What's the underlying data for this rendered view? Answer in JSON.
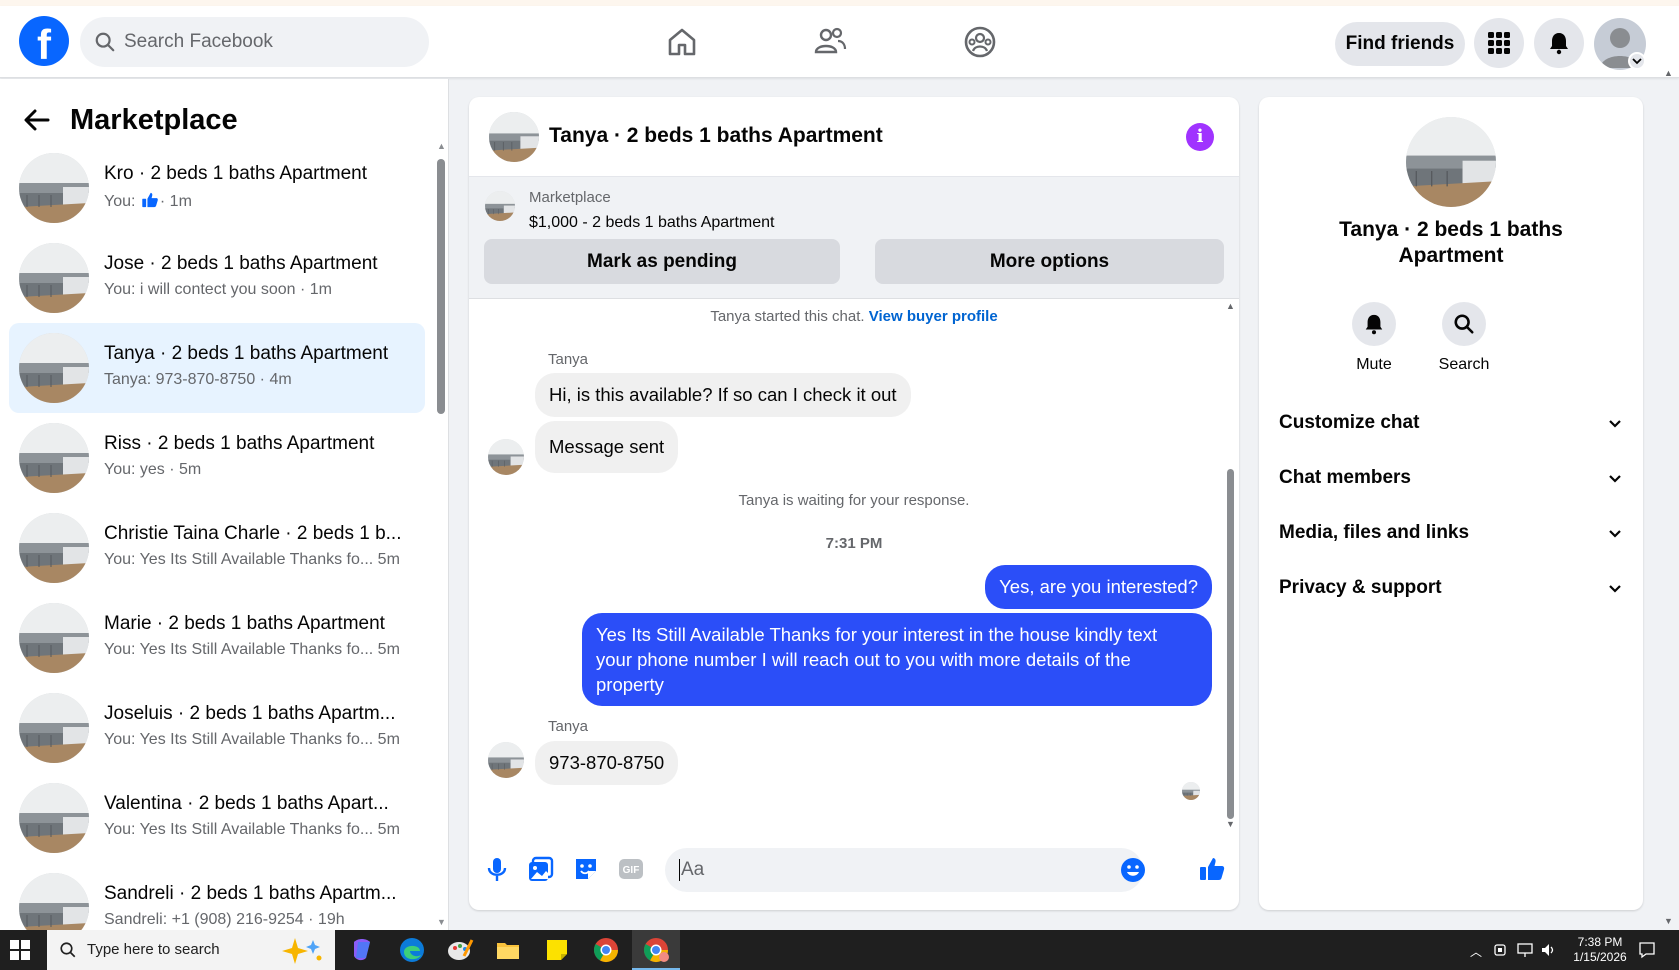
{
  "header": {
    "search_placeholder": "Search Facebook",
    "find_friends": "Find friends",
    "accent": "#0866ff"
  },
  "sidebar": {
    "title": "Marketplace",
    "conversations": [
      {
        "name": "Kro · 2 beds 1 baths Apartment",
        "sub_prefix": "You:",
        "sub": "· 1m",
        "like": true,
        "active": false
      },
      {
        "name": "Jose · 2 beds 1 baths Apartment",
        "sub": "You: i will contect you soon · 1m",
        "active": false
      },
      {
        "name": "Tanya · 2 beds 1 baths Apartment",
        "sub": "Tanya: 973-870-8750 · 4m",
        "active": true
      },
      {
        "name": "Riss · 2 beds 1 baths Apartment",
        "sub": "You: yes · 5m",
        "active": false
      },
      {
        "name": "Christie Taina Charle · 2 beds 1 b...",
        "sub": "You: Yes Its Still Available Thanks fo...  5m",
        "active": false
      },
      {
        "name": "Marie · 2 beds 1 baths Apartment",
        "sub": "You: Yes Its Still Available Thanks fo...  5m",
        "active": false
      },
      {
        "name": "Joseluis · 2 beds 1 baths Apartm...",
        "sub": "You: Yes Its Still Available Thanks fo...  5m",
        "active": false
      },
      {
        "name": "Valentina · 2 beds 1 baths Apart...",
        "sub": "You: Yes Its Still Available Thanks fo...  5m",
        "active": false
      },
      {
        "name": "Sandreli · 2 beds 1 baths Apartm...",
        "sub": "Sandreli: +1 (908) 216-9254 · 19h",
        "active": false
      }
    ]
  },
  "chat": {
    "title": "Tanya · 2 beds 1 baths Apartment",
    "marketplace_label": "Marketplace",
    "listing": "$1,000 - 2 beds 1 baths Apartment",
    "mark_pending": "Mark as pending",
    "more_options": "More options",
    "started_text": "Tanya started this chat.",
    "view_buyer_profile": "View buyer profile",
    "sender_name": "Tanya",
    "msg_1": "Hi, is this available? If so can I check it out",
    "msg_2": "Message sent",
    "waiting_text": "Tanya is waiting for your response.",
    "timestamp": "7:31 PM",
    "msg_3": "Yes, are you interested?",
    "msg_4": "Yes Its Still Available Thanks for your interest in the house kindly text your phone number I will reach out to you with more details of the property",
    "sender_name_2": "Tanya",
    "msg_5": "973-870-8750",
    "compose_placeholder": "Aa",
    "outgoing_color": "#2b4ef8",
    "info_color": "#a033ff"
  },
  "right_panel": {
    "title": "Tanya · 2 beds 1 baths Apartment",
    "mute": "Mute",
    "search": "Search",
    "sections": [
      "Customize chat",
      "Chat members",
      "Media, files and links",
      "Privacy & support"
    ]
  },
  "taskbar": {
    "search_text": "Type here to search",
    "time": "7:38 PM",
    "date": "1/15/2026"
  }
}
